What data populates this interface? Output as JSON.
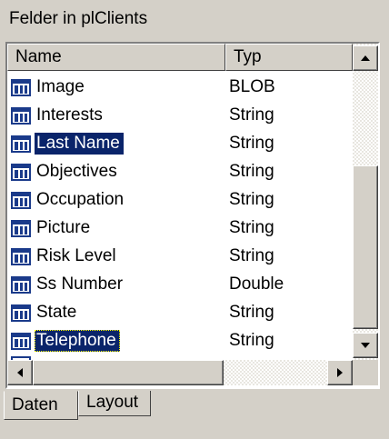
{
  "panel": {
    "title": "Felder in plClients"
  },
  "columns": {
    "name": "Name",
    "type": "Typ"
  },
  "rows": [
    {
      "name": "Image",
      "type": "BLOB",
      "selected": false,
      "focused": false
    },
    {
      "name": "Interests",
      "type": "String",
      "selected": false,
      "focused": false
    },
    {
      "name": "Last Name",
      "type": "String",
      "selected": true,
      "focused": false
    },
    {
      "name": "Objectives",
      "type": "String",
      "selected": false,
      "focused": false
    },
    {
      "name": "Occupation",
      "type": "String",
      "selected": false,
      "focused": false
    },
    {
      "name": "Picture",
      "type": "String",
      "selected": false,
      "focused": false
    },
    {
      "name": "Risk Level",
      "type": "String",
      "selected": false,
      "focused": false
    },
    {
      "name": "Ss Number",
      "type": "Double",
      "selected": false,
      "focused": false
    },
    {
      "name": "State",
      "type": "String",
      "selected": false,
      "focused": false
    },
    {
      "name": "Telephone",
      "type": "String",
      "selected": true,
      "focused": true
    }
  ],
  "tabs": {
    "daten": "Daten",
    "layout": "Layout"
  },
  "colors": {
    "selection": "#0a246a",
    "face": "#d4d0c8",
    "icon_blue": "#1a3a8a"
  },
  "icons": {
    "field": "field-table-icon"
  }
}
